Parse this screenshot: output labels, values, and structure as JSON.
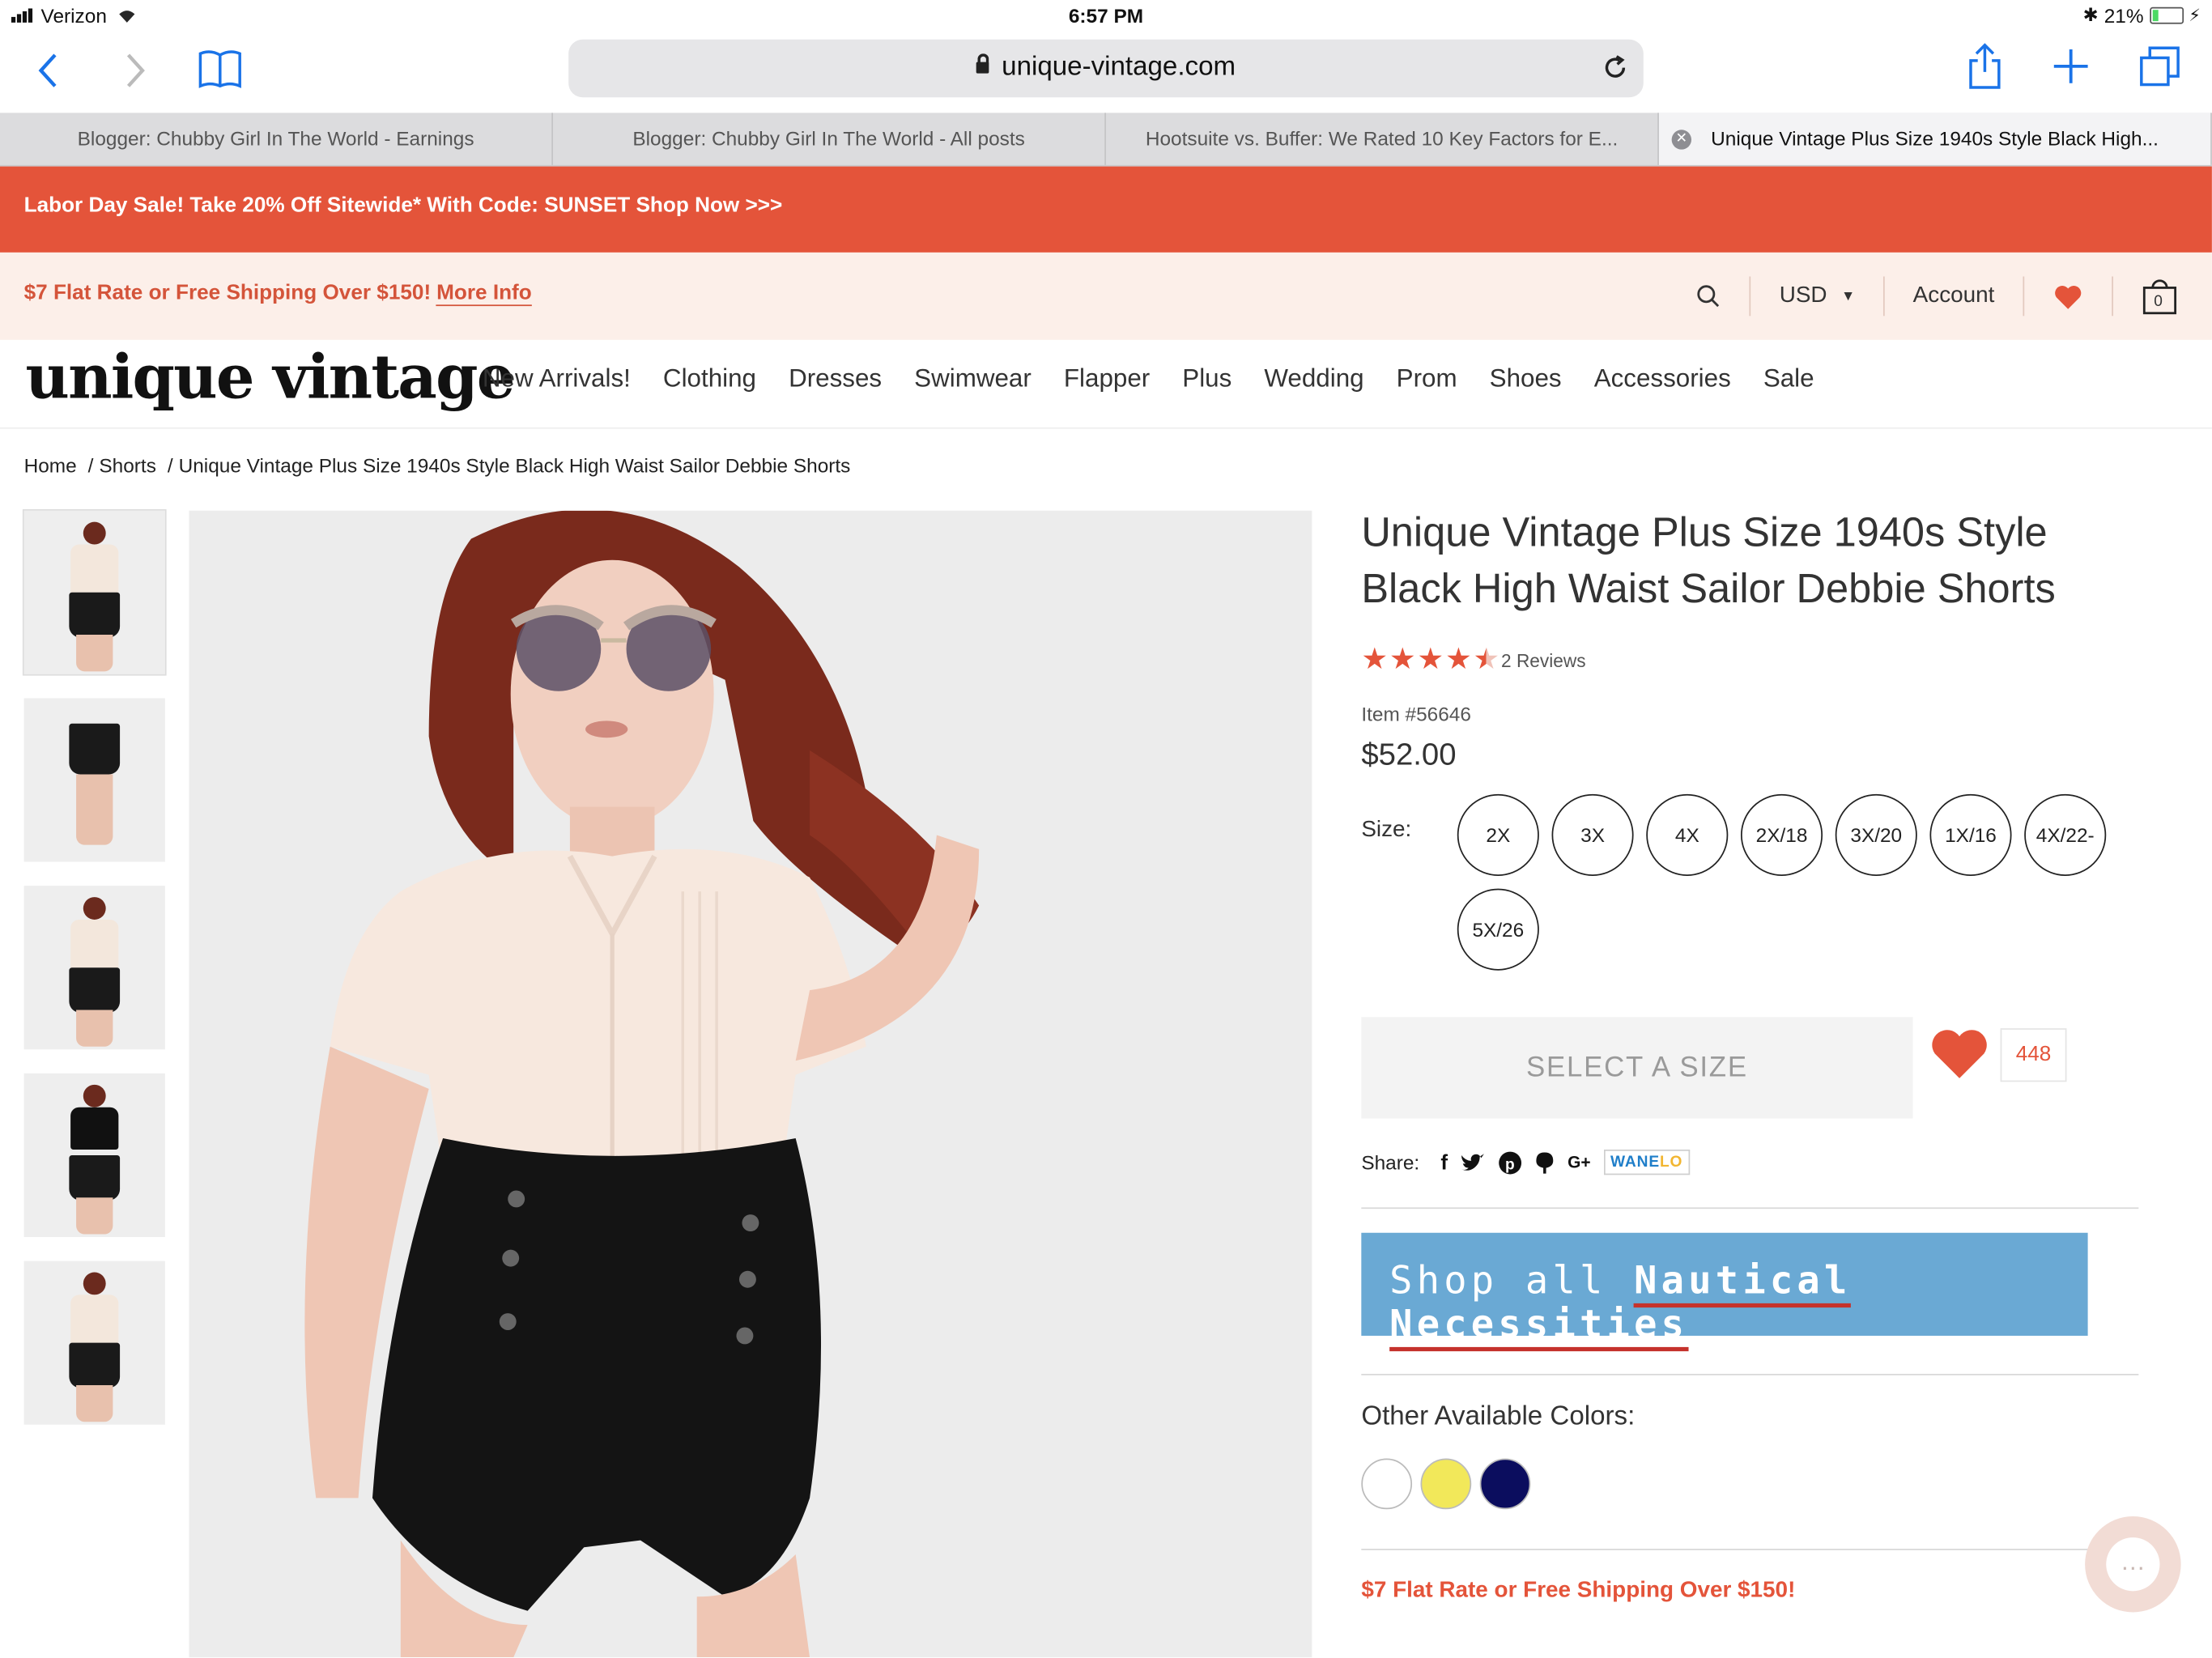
{
  "status": {
    "carrier": "Verizon",
    "time": "6:57 PM",
    "battery": "21%",
    "battery_level": 0.21
  },
  "browser": {
    "url": "unique-vintage.com",
    "tabs": [
      "Blogger: Chubby Girl In The World - Earnings",
      "Blogger: Chubby Girl In The World - All posts",
      "Hootsuite vs. Buffer: We Rated 10 Key Factors for E...",
      "Unique Vintage Plus Size 1940s Style Black High..."
    ]
  },
  "promo": "Labor Day Sale! Take 20% Off Sitewide* With Code: SUNSET Shop Now >>>",
  "shipping": {
    "text": "$7 Flat Rate or Free Shipping Over $150!",
    "link": "More Info"
  },
  "header": {
    "currency": "USD",
    "account": "Account",
    "cart_count": "0"
  },
  "logo": "unique vintage",
  "nav": [
    "New Arrivals!",
    "Clothing",
    "Dresses",
    "Swimwear",
    "Flapper",
    "Plus",
    "Wedding",
    "Prom",
    "Shoes",
    "Accessories",
    "Sale"
  ],
  "breadcrumb": {
    "home": "Home",
    "category": "Shorts",
    "current": "Unique Vintage Plus Size 1940s Style Black High Waist Sailor Debbie Shorts"
  },
  "product": {
    "title": "Unique Vintage Plus Size 1940s Style Black High Waist Sailor Debbie Shorts",
    "rating": 4.5,
    "reviews": "2 Reviews",
    "item": "Item #56646",
    "price": "$52.00",
    "size_label": "Size:",
    "sizes": [
      "2X",
      "3X",
      "4X",
      "2X/18",
      "3X/20",
      "1X/16",
      "4X/22-",
      "5X/26"
    ],
    "select_button": "SELECT A SIZE",
    "fav_count": "448",
    "share_label": "Share:",
    "share_fb": "f",
    "share_gplus": "G+",
    "wanelo_a": "WANE",
    "wanelo_b": "LO",
    "banner_prefix": "Shop all",
    "banner_highlight": "Nautical Necessities",
    "other_colors_label": "Other Available Colors:",
    "colors": [
      "#ffffff",
      "#f2e85a",
      "#0b0d5e"
    ],
    "shipping_note": "$7 Flat Rate or Free Shipping Over $150!"
  },
  "colors": {
    "accent": "#e4543a",
    "promo_bg": "#e4543a",
    "ship_bg": "#fcefe9",
    "banner": "#6aa9d4"
  }
}
